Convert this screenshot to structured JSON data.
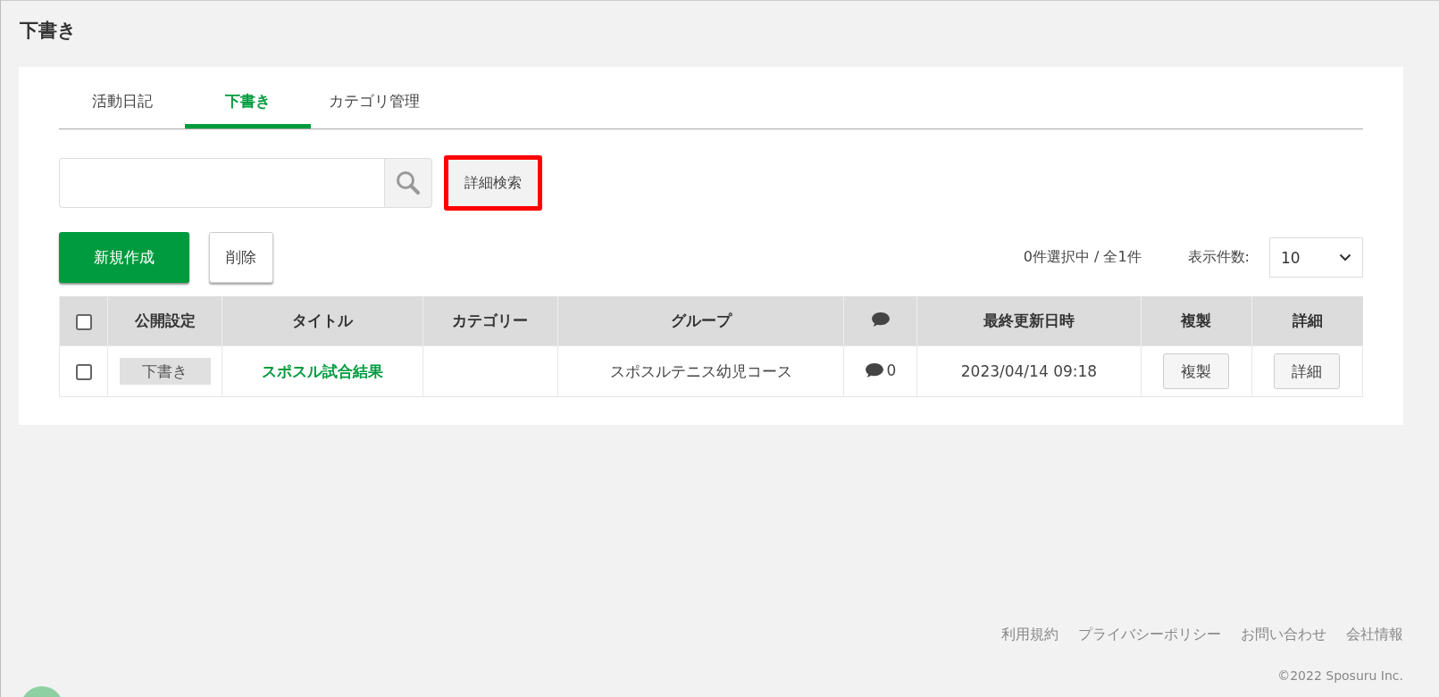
{
  "page_title": "下書き",
  "tabs": [
    {
      "label": "活動日記",
      "selected": false
    },
    {
      "label": "下書き",
      "selected": true
    },
    {
      "label": "カテゴリ管理",
      "selected": false
    }
  ],
  "search": {
    "advanced_button": {
      "label": "詳細検索",
      "highlighted": true
    }
  },
  "actions": {
    "create": "新規作成",
    "delete": "削除"
  },
  "selection_summary": "0件選択中 / 全1件",
  "page_size": {
    "label": "表示件数:",
    "value": "10"
  },
  "table": {
    "select_all_checked": false,
    "columns": [
      "公開設定",
      "タイトル",
      "カテゴリー",
      "グループ",
      "最終更新日時",
      "複製",
      "詳細"
    ],
    "rows": [
      {
        "checked": false,
        "status": "下書き",
        "title": "スポスル試合結果",
        "group": "スポスルテニス幼児コース",
        "comments": "0",
        "updated": "2023/04/14 09:18",
        "copy": "複製",
        "detail": "詳細"
      }
    ]
  },
  "footer": {
    "links": [
      "利用規約",
      "プライバシーポリシー",
      "お問い合わせ",
      "会社情報"
    ],
    "copyright": "©2022 Sposuru Inc."
  }
}
